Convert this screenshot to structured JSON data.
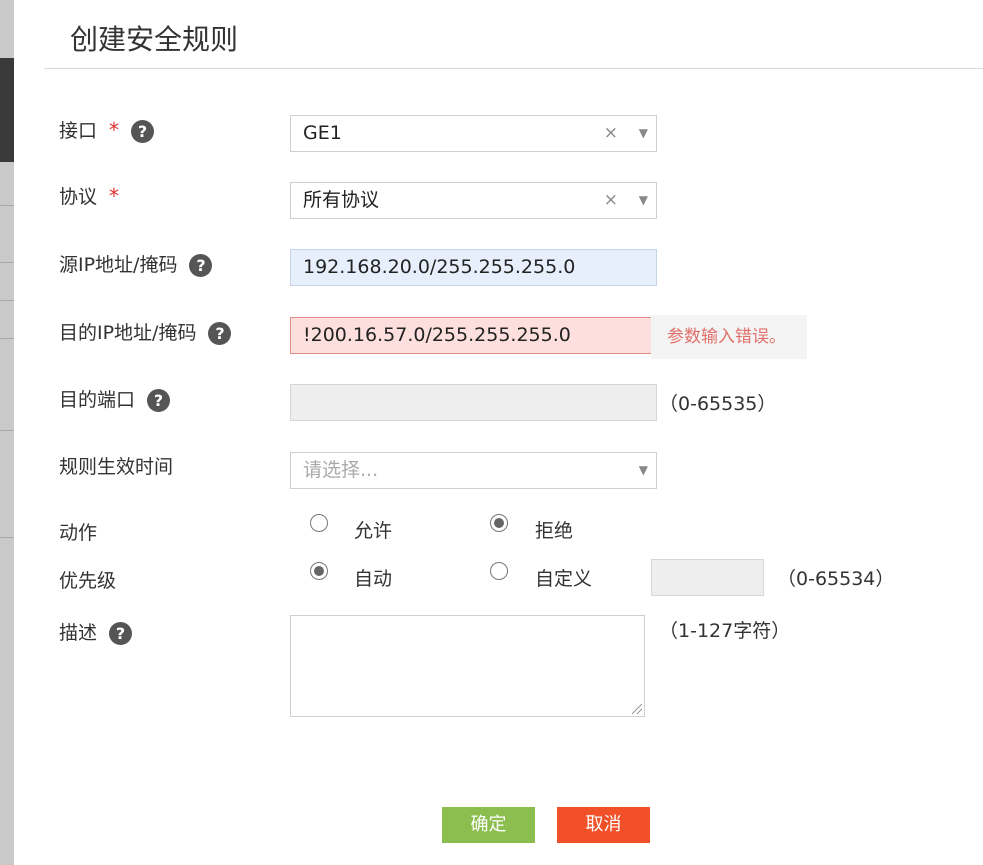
{
  "dialog": {
    "title": "创建安全规则"
  },
  "form": {
    "interface": {
      "label": "接口",
      "required_mark": "*",
      "value": "GE1",
      "clear_glyph": "×",
      "caret_glyph": "▼"
    },
    "protocol": {
      "label": "协议",
      "required_mark": "*",
      "value": "所有协议",
      "clear_glyph": "×",
      "caret_glyph": "▼"
    },
    "source_ip": {
      "label": "源IP地址/掩码",
      "value": "192.168.20.0/255.255.255.0"
    },
    "dest_ip": {
      "label": "目的IP地址/掩码",
      "value": "!200.16.57.0/255.255.255.0",
      "error": "参数输入错误。"
    },
    "dest_port": {
      "label": "目的端口",
      "value": "",
      "range": "（0-65535）"
    },
    "schedule": {
      "label": "规则生效时间",
      "placeholder": "请选择...",
      "caret_glyph": "▼"
    },
    "action": {
      "label": "动作",
      "options": [
        "允许",
        "拒绝"
      ],
      "selected": "拒绝"
    },
    "priority": {
      "label": "优先级",
      "options": [
        "自动",
        "自定义"
      ],
      "selected": "自动",
      "custom_value": "",
      "range": "（0-65534）"
    },
    "description": {
      "label": "描述",
      "value": "",
      "range": "（1-127字符）"
    },
    "help_glyph": "?"
  },
  "buttons": {
    "ok": "确定",
    "cancel": "取消"
  },
  "colors": {
    "ok": "#8cbd4f",
    "cancel": "#f25028",
    "error_text": "#e06f6a",
    "error_bg": "#fde0de",
    "required": "#e03030"
  }
}
